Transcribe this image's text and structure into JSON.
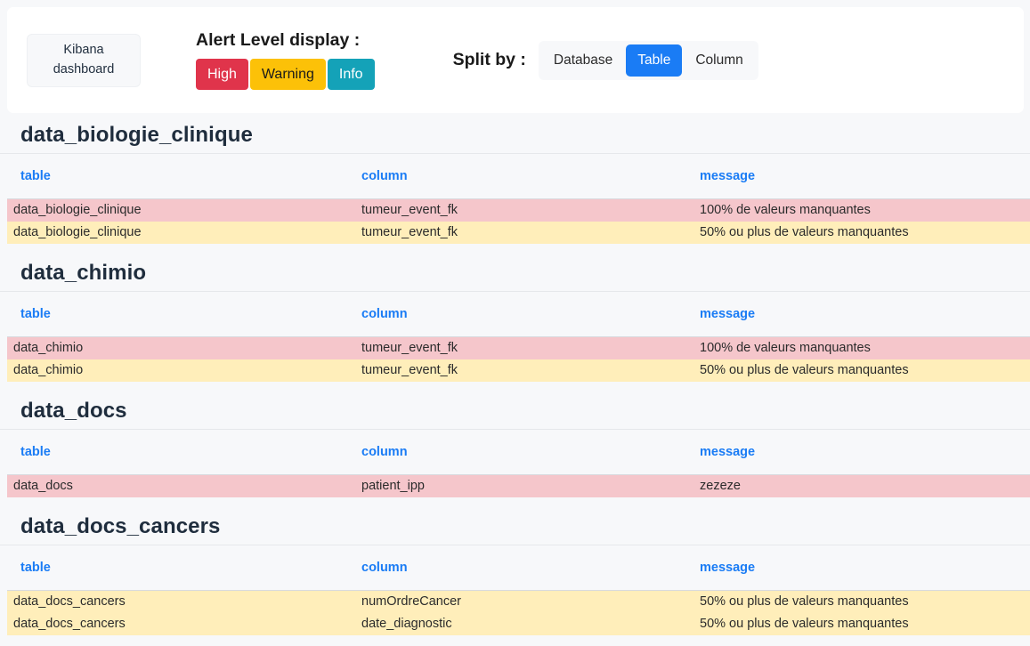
{
  "toolbar": {
    "kibana_button": {
      "line1": "Kibana",
      "line2": "dashboard"
    },
    "alert_level": {
      "title": "Alert Level display :",
      "levels": [
        {
          "label": "High",
          "color": "#e0344b",
          "text_color": "#ffffff"
        },
        {
          "label": "Warning",
          "color": "#fcc108",
          "text_color": "#1a1a1a"
        },
        {
          "label": "Info",
          "color": "#14a2b8",
          "text_color": "#ffffff"
        }
      ]
    },
    "split_by": {
      "label": "Split by :",
      "options": [
        "Database",
        "Table",
        "Column"
      ],
      "selected": "Table"
    }
  },
  "columns": [
    "table",
    "column",
    "message"
  ],
  "sections": [
    {
      "title": "data_biologie_clinique",
      "rows": [
        {
          "level": "high",
          "table": "data_biologie_clinique",
          "column": "tumeur_event_fk",
          "message": "100% de valeurs manquantes"
        },
        {
          "level": "warn",
          "table": "data_biologie_clinique",
          "column": "tumeur_event_fk",
          "message": "50% ou plus de valeurs manquantes"
        }
      ]
    },
    {
      "title": "data_chimio",
      "rows": [
        {
          "level": "high",
          "table": "data_chimio",
          "column": "tumeur_event_fk",
          "message": "100% de valeurs manquantes"
        },
        {
          "level": "warn",
          "table": "data_chimio",
          "column": "tumeur_event_fk",
          "message": "50% ou plus de valeurs manquantes"
        }
      ]
    },
    {
      "title": "data_docs",
      "rows": [
        {
          "level": "high",
          "table": "data_docs",
          "column": "patient_ipp",
          "message": "zezeze"
        }
      ]
    },
    {
      "title": "data_docs_cancers",
      "rows": [
        {
          "level": "warn",
          "table": "data_docs_cancers",
          "column": "numOrdreCancer",
          "message": "50% ou plus de valeurs manquantes"
        },
        {
          "level": "warn",
          "table": "data_docs_cancers",
          "column": "date_diagnostic",
          "message": "50% ou plus de valeurs manquantes"
        }
      ]
    }
  ]
}
